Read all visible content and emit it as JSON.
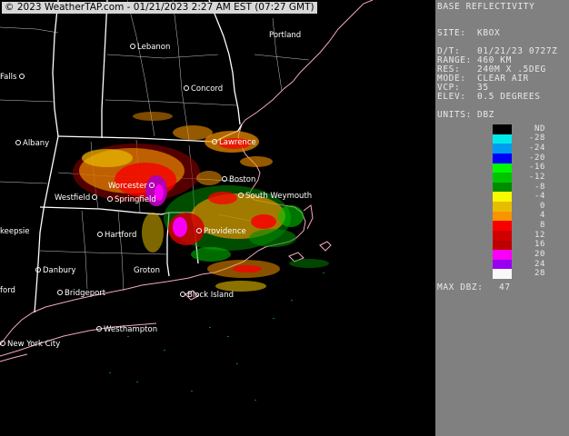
{
  "credit": "© 2023 WeatherTAP.com - 01/21/2023  2:27 AM EST (07:27 GMT)",
  "panel": {
    "title": "BASE REFLECTIVITY",
    "site_label": "SITE:",
    "site_value": "KBOX",
    "dt_label": "D/T:",
    "dt_value": "01/21/23 0727Z",
    "range_label": "RANGE:",
    "range_value": "460 KM",
    "res_label": "RES:",
    "res_value": "240M X .5DEG",
    "mode_label": "MODE:",
    "mode_value": "CLEAR AIR",
    "vcp_label": "VCP:",
    "vcp_value": "35",
    "elev_label": "ELEV:",
    "elev_value": "0.5 DEGREES",
    "units_label": "UNITS:",
    "units_value": "DBZ",
    "maxdbz_label": "MAX DBZ:",
    "maxdbz_value": "47"
  },
  "scale": {
    "labels": [
      "ND",
      "-28",
      "-24",
      "-20",
      "-16",
      "-12",
      "-8",
      "-4",
      "0",
      "4",
      "8",
      "12",
      "16",
      "20",
      "24",
      "28"
    ],
    "colors": [
      "#000000",
      "#00e8e8",
      "#009cf0",
      "#0000f8",
      "#00f800",
      "#00c400",
      "#008c00",
      "#f8f800",
      "#e8bc00",
      "#f89400",
      "#f80000",
      "#d00000",
      "#bc0000",
      "#f800f8",
      "#9800f0",
      "#f8f8f8"
    ]
  },
  "cities": [
    {
      "name": "Lebanon"
    },
    {
      "name": "Portland"
    },
    {
      "name": "Falls"
    },
    {
      "name": "Concord"
    },
    {
      "name": "Albany"
    },
    {
      "name": "Lawrence"
    },
    {
      "name": "Worcester"
    },
    {
      "name": "Boston"
    },
    {
      "name": "Westfield"
    },
    {
      "name": "Springfield"
    },
    {
      "name": "South Weymouth"
    },
    {
      "name": "keepsie"
    },
    {
      "name": "Hartford"
    },
    {
      "name": "Providence"
    },
    {
      "name": "Danbury"
    },
    {
      "name": "Groton"
    },
    {
      "name": "ford"
    },
    {
      "name": "Bridgeport"
    },
    {
      "name": "Block Island"
    },
    {
      "name": "Westhampton"
    },
    {
      "name": "New York City"
    }
  ]
}
